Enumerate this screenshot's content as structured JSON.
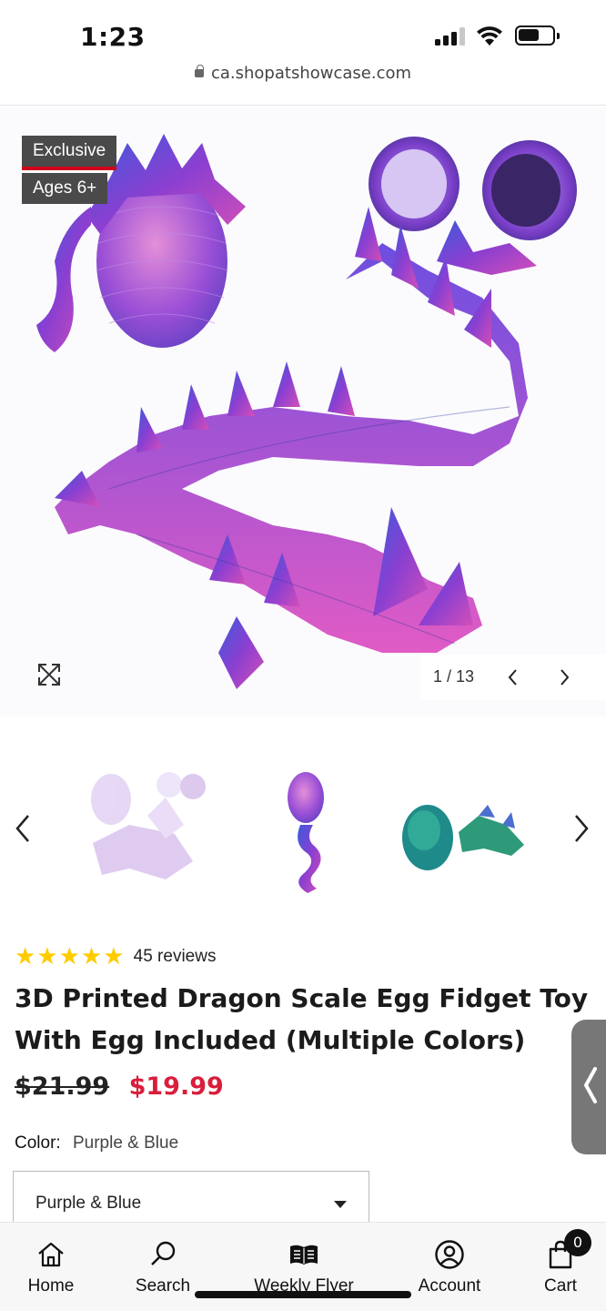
{
  "status_bar": {
    "time": "1:23"
  },
  "browser": {
    "url": "ca.shopatshowcase.com"
  },
  "gallery": {
    "badges": [
      "Exclusive",
      "Ages 6+"
    ],
    "counter": "1 / 13"
  },
  "product": {
    "stars": "★★★★★",
    "rating": 5,
    "reviews_label": "45 reviews",
    "title": "3D Printed Dragon Scale Egg Fidget Toy With Egg Included (Multiple Colors)",
    "old_price": "$21.99",
    "price": "$19.99",
    "color_label": "Color:",
    "color_value": "Purple & Blue",
    "select_value": "Purple & Blue"
  },
  "nav": {
    "home": "Home",
    "search": "Search",
    "flyer": "Weekly Flyer",
    "account": "Account",
    "cart": "Cart",
    "cart_count": "0"
  },
  "colors": {
    "sale_red": "#d81e3b",
    "star_yellow": "#ffcc00",
    "badge_gray": "#4a4a4a",
    "dragon_purple": "#8a3fd1",
    "dragon_blue": "#3b5bdb",
    "dragon_pink": "#d44fb8"
  }
}
